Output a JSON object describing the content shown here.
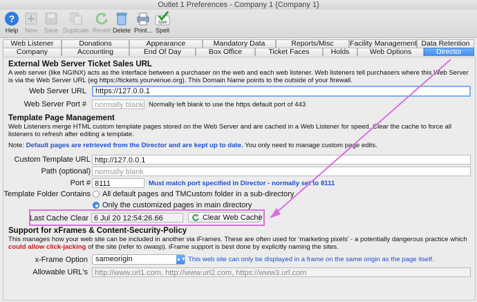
{
  "window": {
    "title": "Outlet 1 Preferences - Company 1 {Company 1}"
  },
  "toolbar": {
    "help": "Help",
    "new": "New",
    "save": "Save",
    "duplicate": "Duplicate",
    "revert": "Revert",
    "delete": "Delete",
    "print": "Print...",
    "spell": "Spell",
    "spell_badge": "Spell"
  },
  "tabs_row1": [
    "Web Listener",
    "Donations",
    "Appearance",
    "Mandatory Data",
    "Reports/Misc",
    "Facility Management",
    "Data Retention"
  ],
  "tabs_row2": [
    "Company",
    "Accounting",
    "End Of Day",
    "Box Office",
    "Ticket Faces",
    "Holds",
    "Web Options",
    "Director"
  ],
  "selected_tab": "Director",
  "external": {
    "header": "External Web Server Ticket Sales URL",
    "desc": "A web server (like NGINX) acts as the interface between a purchaser on the web and each web listener.  Web listeners tell purchasers where this Web Server is via the Web Server URL (eg https://tickets.yourvenue.org). This Domain Name points to the outside of your firewall.",
    "url_label": "Web Server URL",
    "url_value": "https://127.0.0.1",
    "port_label": "Web Server Port #",
    "port_placeholder": "normally blank",
    "port_note": "Normally left blank to use the https default port of 443"
  },
  "template": {
    "header": "Template Page Management",
    "desc": "Web Listeners merge HTML custom template pages stored on the Web Server and are cached in a Web Listener for speed.  Clear the cache to force all listeners to refresh after editing a template.",
    "note_prefix": "Note:",
    "note_blue": "Default pages are retrieved from the Director and are kept up to date.",
    "note_suffix": "You only need to manage custom page edits.",
    "url_label": "Custom Template URL",
    "url_value": "http://127.0.0.1",
    "path_label": "Path (optional)",
    "path_placeholder": "normally blank",
    "port_label": "Port #",
    "port_value": "8111",
    "port_note": "Must match port specified in Director - normally set to 8111",
    "folder_label": "Template Folder Contains",
    "option1": "All default pages and TMCustom folder in a sub-directory",
    "option2": "Only the customized pages in main directory",
    "cache_label": "Last Cache Clear",
    "cache_value": "6 Jul 20  12:54:26.66",
    "clear_button": "Clear Web Cache"
  },
  "xframes": {
    "header": "Support for xFrames & Content-Security-Policy",
    "desc_a": "This manages how your web site can be included in another via iFrames.  These are often used for 'marketing pixels' - a potentially dangerous practice which",
    "desc_red": "could allow click-jacking",
    "desc_b": "of the site (refer to owasp).   iFrame support is best done by explicitly naming the sites.",
    "option_label": "x-Frame Option",
    "option_value": "sameorigin",
    "option_note": "This web site can only be displayed in a frame on the same origin as the page itself.",
    "allowable_label": "Allowable URL's",
    "allowable_placeholder": "http://www.url1.com, http://www.url2.com, https://www3.url.com"
  },
  "colors": {
    "accent": "#3f8df0",
    "highlight": "#d96ee0",
    "note_blue": "#1f4fd0",
    "warning_red": "#d0101a"
  }
}
